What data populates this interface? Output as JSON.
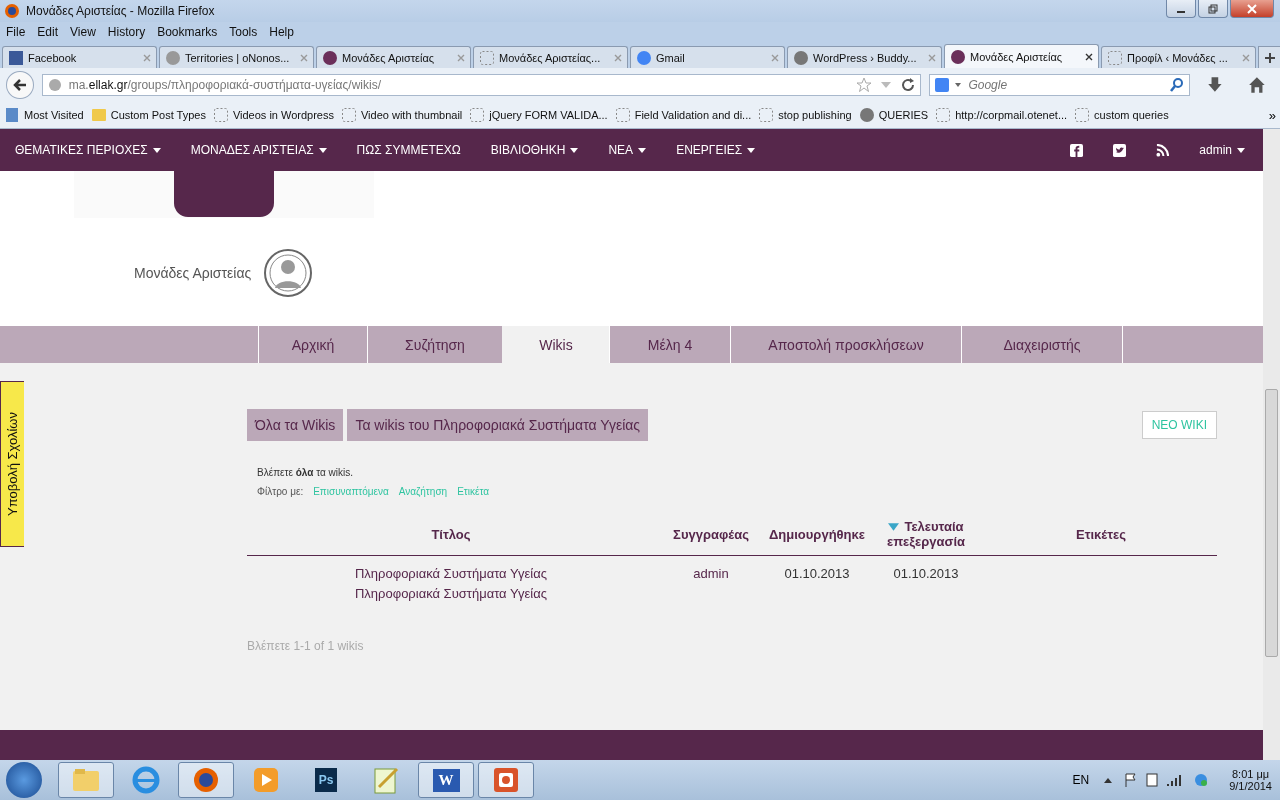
{
  "window": {
    "title": "Μονάδες Αριστείας - Mozilla Firefox"
  },
  "menu": [
    "File",
    "Edit",
    "View",
    "History",
    "Bookmarks",
    "Tools",
    "Help"
  ],
  "browser_tabs": [
    {
      "title": "Facebook",
      "kind": "facebook",
      "selected": false
    },
    {
      "title": "Territories | oNonos...",
      "kind": "image",
      "selected": false
    },
    {
      "title": "Μονάδες Αριστείας",
      "kind": "site",
      "selected": false
    },
    {
      "title": "Μονάδες Αριστείας...",
      "kind": "blank",
      "selected": false
    },
    {
      "title": "Gmail",
      "kind": "google",
      "selected": false
    },
    {
      "title": "WordPress › Buddy...",
      "kind": "wordpress",
      "selected": false
    },
    {
      "title": "Μονάδες Αριστείας",
      "kind": "site",
      "selected": true
    },
    {
      "title": "Προφίλ ‹ Μονάδες ...",
      "kind": "blank",
      "selected": false
    }
  ],
  "address": {
    "host_prefix": "ma.",
    "host": "ellak.gr",
    "path": "/groups/πληροφοριακά-συστήματα-υγείας/wikis/"
  },
  "search": {
    "placeholder": "Google"
  },
  "bookmarks": [
    {
      "label": "Most Visited",
      "kind": "page"
    },
    {
      "label": "Custom Post Types",
      "kind": "folder"
    },
    {
      "label": "Videos in Wordpress",
      "kind": "blank"
    },
    {
      "label": "Video with thumbnail",
      "kind": "blank"
    },
    {
      "label": "jQuery FORM VALIDA...",
      "kind": "blank"
    },
    {
      "label": "Field Validation and di...",
      "kind": "blank"
    },
    {
      "label": "stop publishing",
      "kind": "blank"
    },
    {
      "label": "QUERIES",
      "kind": "wordpress"
    },
    {
      "label": "http://corpmail.otenet...",
      "kind": "blank"
    },
    {
      "label": "custom queries",
      "kind": "blank"
    }
  ],
  "bookmarks_more": "»",
  "site_nav": [
    {
      "label": "ΘΕΜΑΤΙΚΕΣ ΠΕΡΙΟΧΕΣ",
      "dropdown": true
    },
    {
      "label": "ΜΟΝΑΔΕΣ ΑΡΙΣΤΕΙΑΣ",
      "dropdown": true
    },
    {
      "label": "ΠΩΣ ΣΥΜΜΕΤΕΧΩ",
      "dropdown": false
    },
    {
      "label": "ΒΙΒΛΙΟΘΗΚΗ",
      "dropdown": true
    },
    {
      "label": "ΝΕΑ",
      "dropdown": true
    },
    {
      "label": "ΕΝΕΡΓΕΙΕΣ",
      "dropdown": true
    }
  ],
  "user": "admin",
  "site_name": "Μονάδες Αριστείας",
  "feedback_tab": "Υποβολή Σχολίων",
  "group_tabs": [
    {
      "label": "Αρχική",
      "selected": false
    },
    {
      "label": "Συζήτηση",
      "selected": false
    },
    {
      "label": "Wikis",
      "selected": true
    },
    {
      "label": "Μέλη 4",
      "selected": false
    },
    {
      "label": "Αποστολή προσκλήσεων",
      "selected": false
    },
    {
      "label": "Διαχειριστής",
      "selected": false
    }
  ],
  "sub_tabs": [
    "Όλα τα Wikis",
    "Τα wikis του Πληροφοριακά Συστήματα Υγείας"
  ],
  "new_wiki_button": "ΝΕΟ WIKI",
  "viewing_note": "Βλέπετε **όλα** τα wikis.",
  "filter": {
    "label": "Φίλτρο με:",
    "links": [
      "Επισυναπτόμενα",
      "Αναζήτηση",
      "Ετικέτα"
    ]
  },
  "table": {
    "columns": [
      {
        "label": "Τίτλος",
        "sorted": false
      },
      {
        "label": "Συγγραφέας",
        "sorted": false
      },
      {
        "label": "Δημιουργήθηκε",
        "sorted": false
      },
      {
        "label": "Τελευταία επεξεργασία",
        "sorted": true
      },
      {
        "label": "Ετικέτες",
        "sorted": false
      }
    ],
    "rows": [
      {
        "title": "Πληροφοριακά Συστήματα Υγείας",
        "group": "Πληροφοριακά Συστήματα Υγείας",
        "author": "admin",
        "created": "01.10.2013",
        "modified": "01.10.2013"
      }
    ]
  },
  "pagination": "Βλέπετε 1-1 of 1 wikis",
  "taskbar": {
    "apps": [
      {
        "kind": "explorer",
        "open": true
      },
      {
        "kind": "ie",
        "open": false
      },
      {
        "kind": "firefox",
        "open": true
      },
      {
        "kind": "media",
        "open": false
      },
      {
        "kind": "photoshop",
        "open": false,
        "label": "Ps"
      },
      {
        "kind": "notepad",
        "open": false
      },
      {
        "kind": "word",
        "open": true,
        "label": "W"
      },
      {
        "kind": "powerpoint",
        "open": true
      }
    ],
    "language": "EN",
    "time": "8:01 μμ",
    "date": "9/1/2014"
  }
}
